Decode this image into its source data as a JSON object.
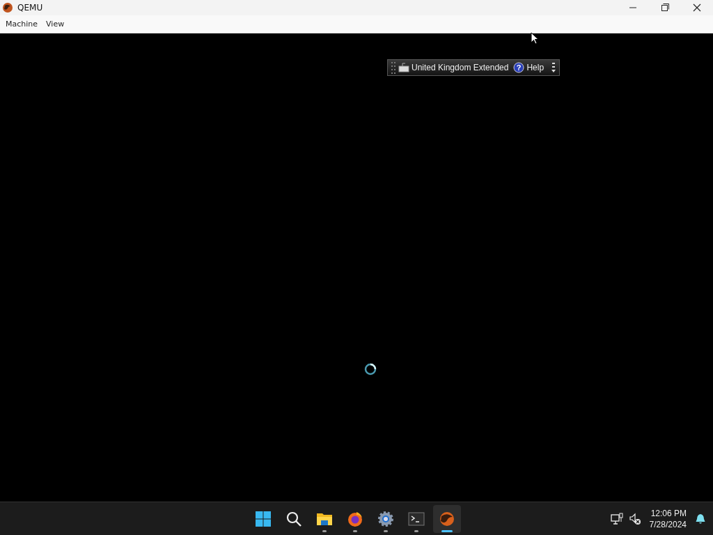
{
  "window": {
    "title": "QEMU"
  },
  "menu": [
    "Machine",
    "View"
  ],
  "language_bar": {
    "language": "United Kingdom Extended",
    "help_mark": "?",
    "help": "Help"
  },
  "taskbar": {
    "apps": [
      {
        "kind": "start",
        "running": false,
        "active": false
      },
      {
        "kind": "search",
        "running": false,
        "active": false
      },
      {
        "kind": "folder",
        "running": true,
        "active": false
      },
      {
        "kind": "browser",
        "running": true,
        "active": false
      },
      {
        "kind": "gear",
        "running": true,
        "active": false
      },
      {
        "kind": "terminal",
        "running": true,
        "active": false
      },
      {
        "kind": "qemu",
        "running": true,
        "active": true
      }
    ],
    "time": "12:06 PM",
    "date": "7/28/2024"
  }
}
